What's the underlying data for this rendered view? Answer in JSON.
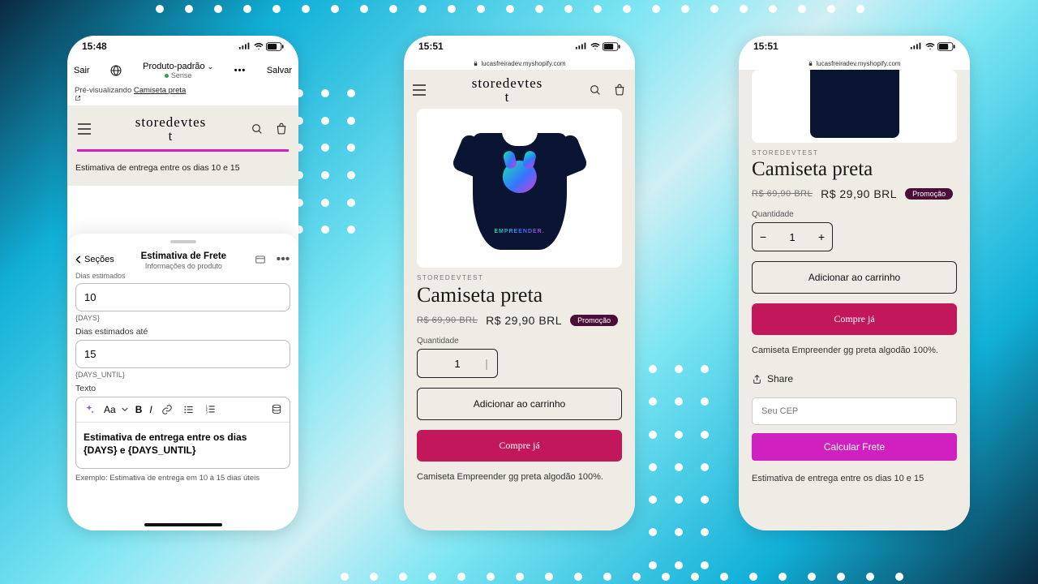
{
  "status": {
    "timeA": "15:48",
    "timeB": "15:51",
    "timeC": "15:51"
  },
  "url": "lucasfreiradev.myshopify.com",
  "editor": {
    "exit": "Sair",
    "save": "Salvar",
    "template": "Produto-padrão",
    "theme": "Sense",
    "previewing": "Pré-visualizando",
    "previewing_link": "Camiseta preta",
    "preview_store_name": "storedevtest",
    "preview_estimate": "Estimativa de entrega entre os dias 10 e 15",
    "sheet": {
      "back": "Seções",
      "title": "Estimativa de Frete",
      "subtitle": "Informações do produto",
      "truncated_label": "Dias estimados",
      "days_value": "10",
      "days_hint": "{DAYS}",
      "until_label": "Dias estimados até",
      "until_value": "15",
      "until_hint": "{DAYS_UNTIL}",
      "text_label": "Texto",
      "font_label": "Aa",
      "rte_value": "Estimativa de entrega entre os dias {DAYS} e {DAYS_UNTIL}",
      "example": "Exemplo: Estimativa de entrega em 10 à 15 dias úteis"
    }
  },
  "product": {
    "store": "storedevtest",
    "vendor": "STOREDEVTEST",
    "title": "Camiseta preta",
    "old_price": "R$ 69,90 BRL",
    "price": "R$ 29,90 BRL",
    "promo": "Promoção",
    "qty_label": "Quantidade",
    "qty_value": "1",
    "add": "Adicionar ao carrinho",
    "buy": "Compre já",
    "description": "Camiseta Empreender gg preta algodão 100%.",
    "tee_brand": "EMPREENDER."
  },
  "phoneC": {
    "share": "Share",
    "cep_placeholder": "Seu CEP",
    "calc": "Calcular Frete",
    "estimate": "Estimativa de entrega entre os dias 10 e 15"
  }
}
